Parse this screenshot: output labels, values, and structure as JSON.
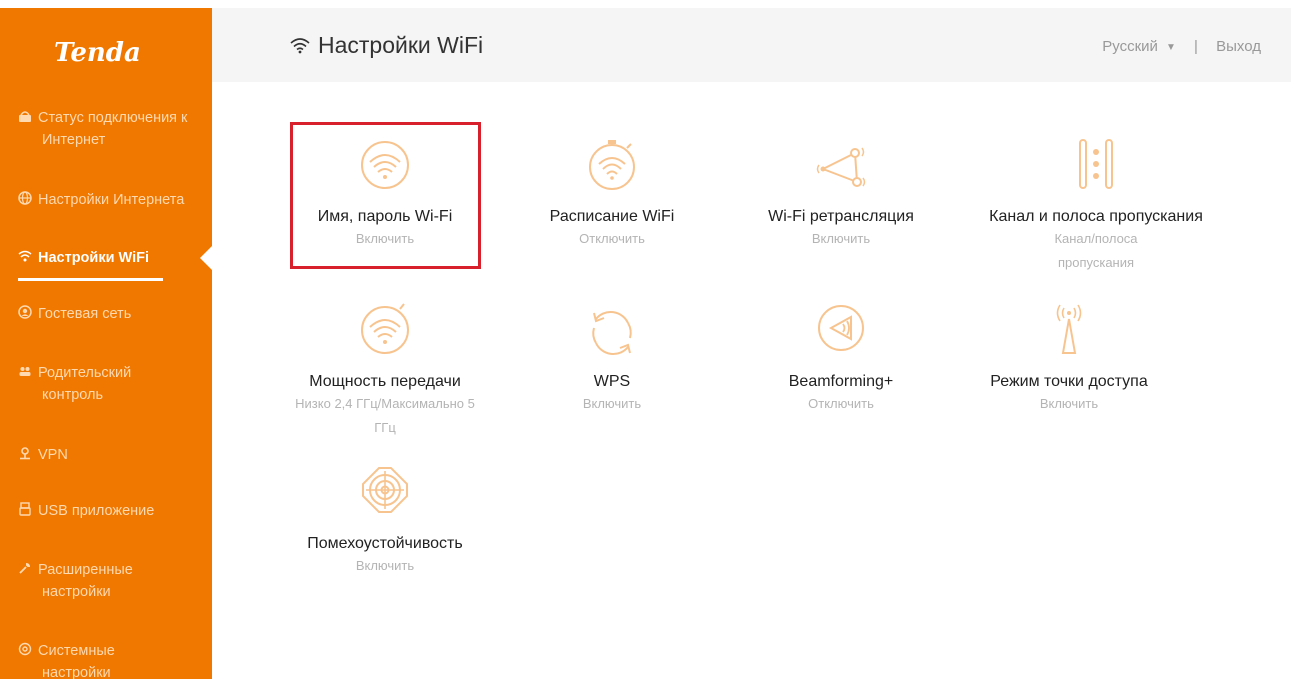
{
  "brand": {
    "logo_text": "Tenda",
    "accent": "#f07800",
    "highlight": "#d8202c"
  },
  "header": {
    "title": "Настройки WiFi",
    "language": "Русский",
    "separator": "|",
    "logout": "Выход"
  },
  "sidebar": {
    "items": [
      {
        "icon": "internet-status-icon",
        "line1": "Статус подключения к",
        "line2": "Интернет"
      },
      {
        "icon": "globe-icon",
        "line1": "Настройки Интернета",
        "line2": ""
      },
      {
        "icon": "wifi-icon",
        "line1": "Настройки WiFi",
        "line2": ""
      },
      {
        "icon": "guest-network-icon",
        "line1": "Гостевая сеть",
        "line2": ""
      },
      {
        "icon": "parental-control-icon",
        "line1": "Родительский",
        "line2": "контроль"
      },
      {
        "icon": "vpn-icon",
        "line1": "VPN",
        "line2": ""
      },
      {
        "icon": "usb-icon",
        "line1": "USB приложение",
        "line2": ""
      },
      {
        "icon": "wrench-icon",
        "line1": "Расширенные",
        "line2": "настройки"
      },
      {
        "icon": "gear-icon",
        "line1": "Системные",
        "line2": "настройки"
      }
    ],
    "active_index": 2
  },
  "tiles": [
    {
      "icon": "wifi-name-password-icon",
      "label": "Имя, пароль Wi-Fi",
      "status": "Включить"
    },
    {
      "icon": "wifi-schedule-icon",
      "label": "Расписание WiFi",
      "status": "Отключить"
    },
    {
      "icon": "wifi-repeater-icon",
      "label": "Wi-Fi ретрансляция",
      "status": "Включить"
    },
    {
      "icon": "channel-bandwidth-icon",
      "label": "Канал и полоса пропускания",
      "status": "Канал/полоса пропускания"
    },
    {
      "icon": "transmit-power-icon",
      "label": "Мощность передачи",
      "status": "Низко 2,4 ГГц/Максимально 5 ГГц"
    },
    {
      "icon": "wps-icon",
      "label": "WPS",
      "status": "Включить"
    },
    {
      "icon": "beamforming-icon",
      "label": "Beamforming+",
      "status": "Отключить"
    },
    {
      "icon": "access-point-icon",
      "label": "Режим точки доступа",
      "status": "Включить"
    },
    {
      "icon": "anti-interference-icon",
      "label": "Помехоустойчивость",
      "status": "Включить"
    }
  ]
}
